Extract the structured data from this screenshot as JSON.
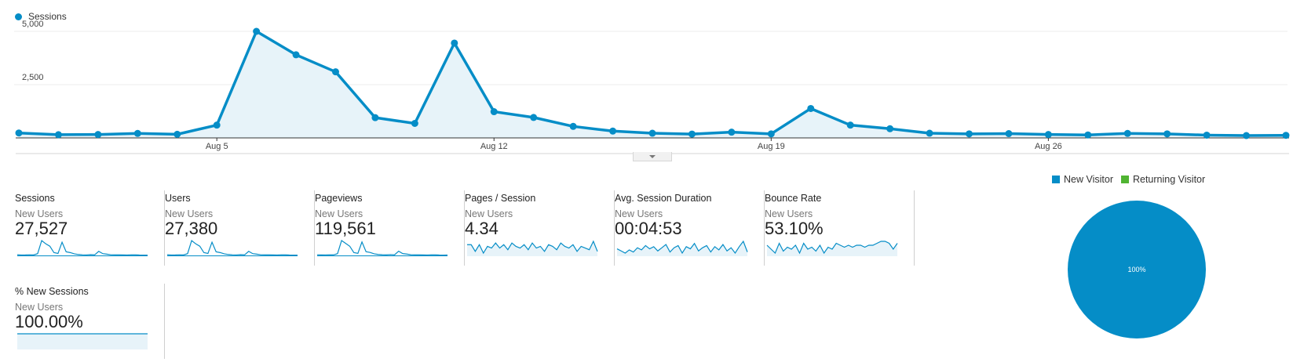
{
  "colors": {
    "accent": "#058dc7",
    "fill": "#e7f3f9",
    "returning": "#50b432"
  },
  "chart": {
    "legend_label": "Sessions",
    "y_ticks": [
      "5,000",
      "2,500"
    ],
    "x_ticks": [
      "Aug 5",
      "Aug 12",
      "Aug 19",
      "Aug 26"
    ]
  },
  "chart_data": {
    "type": "area",
    "series": [
      {
        "name": "Sessions",
        "values": [
          230,
          150,
          160,
          210,
          170,
          600,
          5000,
          3900,
          3100,
          950,
          680,
          4450,
          1230,
          960,
          540,
          320,
          220,
          180,
          270,
          190,
          1380,
          600,
          430,
          220,
          190,
          200,
          160,
          140,
          210,
          190,
          130,
          110,
          120
        ]
      }
    ],
    "x_ticks": [
      "Aug 5",
      "Aug 12",
      "Aug 19",
      "Aug 26"
    ],
    "y_ticks": [
      2500,
      5000
    ],
    "ylim": [
      0,
      5000
    ],
    "grid": true,
    "legend": "top-left"
  },
  "metrics": [
    {
      "title": "Sessions",
      "sub": "New Users",
      "value": "27,527",
      "spark": [
        230,
        150,
        160,
        210,
        170,
        600,
        5000,
        3900,
        3100,
        950,
        680,
        4450,
        1230,
        960,
        540,
        320,
        220,
        180,
        270,
        190,
        1380,
        600,
        430,
        220,
        190,
        200,
        160,
        140,
        210,
        190,
        130,
        110,
        120
      ]
    },
    {
      "title": "Users",
      "sub": "New Users",
      "value": "27,380",
      "spark": [
        230,
        150,
        160,
        210,
        170,
        600,
        5000,
        3900,
        3100,
        950,
        680,
        4450,
        1230,
        960,
        540,
        320,
        220,
        180,
        270,
        190,
        1380,
        600,
        430,
        220,
        190,
        200,
        160,
        140,
        210,
        190,
        130,
        110,
        120
      ]
    },
    {
      "title": "Pageviews",
      "sub": "New Users",
      "value": "119,561",
      "spark": [
        900,
        700,
        750,
        900,
        800,
        2500,
        21000,
        17000,
        13000,
        4000,
        3000,
        19000,
        5300,
        4200,
        2300,
        1400,
        950,
        800,
        1200,
        850,
        6000,
        2600,
        1900,
        950,
        820,
        870,
        700,
        600,
        900,
        820,
        560,
        480,
        520
      ]
    },
    {
      "title": "Pages / Session",
      "sub": "New Users",
      "value": "4.34",
      "spark": [
        4.5,
        4.5,
        4.1,
        4.5,
        4.0,
        4.4,
        4.3,
        4.6,
        4.3,
        4.5,
        4.2,
        4.6,
        4.4,
        4.3,
        4.5,
        4.2,
        4.6,
        4.3,
        4.4,
        4.1,
        4.5,
        4.4,
        4.2,
        4.6,
        4.4,
        4.3,
        4.5,
        4.1,
        4.4,
        4.3,
        4.2,
        4.7,
        4.1
      ]
    },
    {
      "title": "Avg. Session Duration",
      "sub": "New Users",
      "value": "00:04:53",
      "spark": [
        290,
        270,
        250,
        280,
        260,
        300,
        280,
        320,
        290,
        310,
        270,
        300,
        330,
        260,
        300,
        320,
        250,
        310,
        290,
        340,
        270,
        300,
        320,
        260,
        310,
        280,
        330,
        270,
        300,
        250,
        310,
        360,
        260
      ]
    },
    {
      "title": "Bounce Rate",
      "sub": "New Users",
      "value": "53.10%",
      "spark": [
        54,
        52,
        50,
        55,
        51,
        53,
        52,
        54,
        50,
        55,
        52,
        53,
        51,
        54,
        50,
        53,
        52,
        55,
        54,
        53,
        54,
        53,
        54,
        54,
        53,
        54,
        54,
        55,
        56,
        56,
        55,
        52,
        55
      ]
    },
    {
      "title": "% New Sessions",
      "sub": "New Users",
      "value": "100.00%",
      "spark": [
        100,
        100,
        100,
        100,
        100,
        100,
        100,
        100,
        100,
        100,
        100,
        100,
        100,
        100,
        100,
        100,
        100,
        100,
        100,
        100,
        100,
        100,
        100,
        100,
        100,
        100,
        100,
        100,
        100,
        100,
        100,
        100,
        100
      ]
    }
  ],
  "pie": {
    "legend": [
      {
        "label": "New Visitor",
        "color": "#058dc7"
      },
      {
        "label": "Returning Visitor",
        "color": "#50b432"
      }
    ],
    "slices": [
      {
        "label": "New Visitor",
        "value": 100
      },
      {
        "label": "Returning Visitor",
        "value": 0
      }
    ],
    "center_label": "100%"
  }
}
